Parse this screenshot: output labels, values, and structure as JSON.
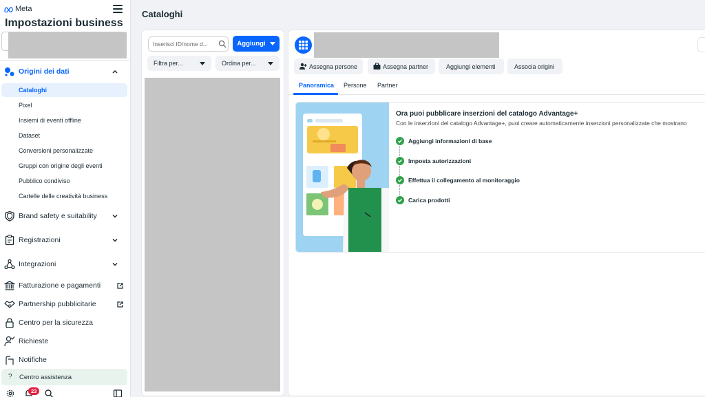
{
  "brand": {
    "logo_text": "Meta"
  },
  "sidebar": {
    "title": "Impostazioni business",
    "sections": {
      "origini": "Origini dei dati",
      "brand_safety": "Brand safety e suitability",
      "registrazioni": "Registrazioni",
      "integrazioni": "Integrazioni",
      "fatturazione": "Fatturazione e pagamenti",
      "partnership": "Partnership pubblicitarie",
      "sicurezza": "Centro per la sicurezza",
      "richieste": "Richieste",
      "notifiche": "Notifiche"
    },
    "sub_items": [
      "Cataloghi",
      "Pixel",
      "Insiemi di eventi offline",
      "Dataset",
      "Conversioni personalizzate",
      "Gruppi con origine degli eventi",
      "Pubblico condiviso",
      "Cartelle delle creatività business"
    ],
    "help": "Centro assistenza",
    "notification_count": "23"
  },
  "main": {
    "page_title": "Cataloghi",
    "search": {
      "placeholder": "Inserisci ID/nome d..."
    },
    "add_button": "Aggiungi",
    "filter_label": "Filtra per...",
    "sort_label": "Ordina per..."
  },
  "detail": {
    "actions": [
      "Assegna persone",
      "Assegna partner",
      "Aggiungi elementi",
      "Associa origini"
    ],
    "tabs": [
      "Panoramica",
      "Persone",
      "Partner"
    ],
    "active_tab": "Panoramica",
    "card": {
      "title": "Ora puoi pubblicare inserzioni del catalogo Advantage+",
      "subtitle": "Con le inserzioni del catalogo Advantage+, puoi creare automaticamente inserzioni personalizzate che mostrano",
      "steps": [
        "Aggiungi informazioni di base",
        "Imposta autorizzazioni",
        "Effettua il collegamento al monitoraggio",
        "Carica prodotti"
      ]
    }
  },
  "colors": {
    "accent": "#0866ff",
    "success": "#31a24c",
    "badge": "#e41e3f",
    "selected_bg": "#e7f0fd",
    "help_bg": "#e8f3ee"
  }
}
